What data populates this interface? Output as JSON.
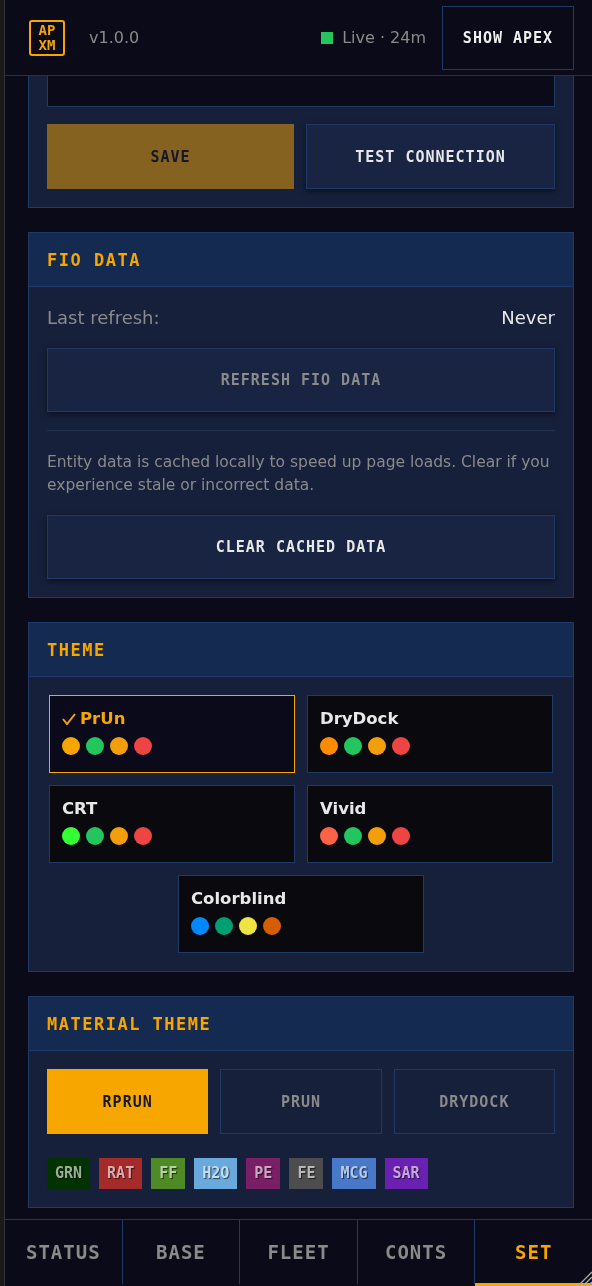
{
  "header": {
    "logo_lines": [
      "AP",
      "XM"
    ],
    "version": "v1.0.0",
    "status": {
      "live": true,
      "text": "Live · 24m"
    },
    "button": "SHOW APEX"
  },
  "api_card": {
    "buttons": [
      {
        "label": "SAVE",
        "kind": "primary"
      },
      {
        "label": "TEST CONNECTION",
        "kind": "secondary"
      }
    ]
  },
  "fio_data": {
    "title": "FIO DATA",
    "last_refresh_label": "Last refresh:",
    "last_refresh_value": "Never",
    "refresh_button": {
      "label": "REFRESH FIO DATA",
      "disabled": true
    },
    "note": "Entity data is cached locally to speed up page loads. Clear if you experience stale or incorrect data.",
    "clear_button": {
      "label": "CLEAR CACHED DATA",
      "disabled": false
    }
  },
  "theme": {
    "title": "THEME",
    "options": [
      {
        "name": "PrUn",
        "selected": true,
        "swatches": [
          {
            "color": "#f7a600"
          },
          {
            "color": "#22c55e"
          },
          {
            "color": "#f59e0b"
          },
          {
            "color": "#ef4444"
          }
        ]
      },
      {
        "name": "DryDock",
        "selected": false,
        "swatches": [
          {
            "color": "#ff8c00"
          },
          {
            "color": "#22c55e"
          },
          {
            "color": "#f59e0b"
          },
          {
            "color": "#ef4444"
          }
        ]
      },
      {
        "name": "CRT",
        "selected": false,
        "swatches": [
          {
            "color": "#33ff33"
          },
          {
            "color": "#22c55e"
          },
          {
            "color": "#f59e0b"
          },
          {
            "color": "#ef4444"
          }
        ]
      },
      {
        "name": "Vivid",
        "selected": false,
        "swatches": [
          {
            "color": "#ff6347"
          },
          {
            "color": "#22c55e"
          },
          {
            "color": "#f59e0b"
          },
          {
            "color": "#ef4444"
          }
        ]
      },
      {
        "name": "Colorblind",
        "selected": false,
        "swatches": [
          {
            "color": "#0088ff"
          },
          {
            "color": "#009e73"
          },
          {
            "color": "#f0e442"
          },
          {
            "color": "#d55e00"
          }
        ]
      }
    ]
  },
  "material_theme": {
    "title": "MATERIAL THEME",
    "options": [
      {
        "label": "RPRUN",
        "selected": true
      },
      {
        "label": "PRUN",
        "selected": false
      },
      {
        "label": "DRYDOCK",
        "selected": false
      }
    ],
    "tags": [
      {
        "label": "GRN",
        "color": "#003300"
      },
      {
        "label": "RAT",
        "color": "#a52a2a"
      },
      {
        "label": "FF",
        "color": "#4e8a25"
      },
      {
        "label": "H2O",
        "color": "#6aa9dc"
      },
      {
        "label": "PE",
        "color": "#7a1f66"
      },
      {
        "label": "FE",
        "color": "#4d4d4d"
      },
      {
        "label": "MCG",
        "color": "#4a78c8"
      },
      {
        "label": "SAR",
        "color": "#6a20b0"
      }
    ]
  },
  "nav": [
    {
      "label": "STATUS",
      "selected": false
    },
    {
      "label": "BASE",
      "selected": false
    },
    {
      "label": "FLEET",
      "selected": false
    },
    {
      "label": "CONTS",
      "selected": false
    },
    {
      "label": "SET",
      "selected": true
    }
  ]
}
